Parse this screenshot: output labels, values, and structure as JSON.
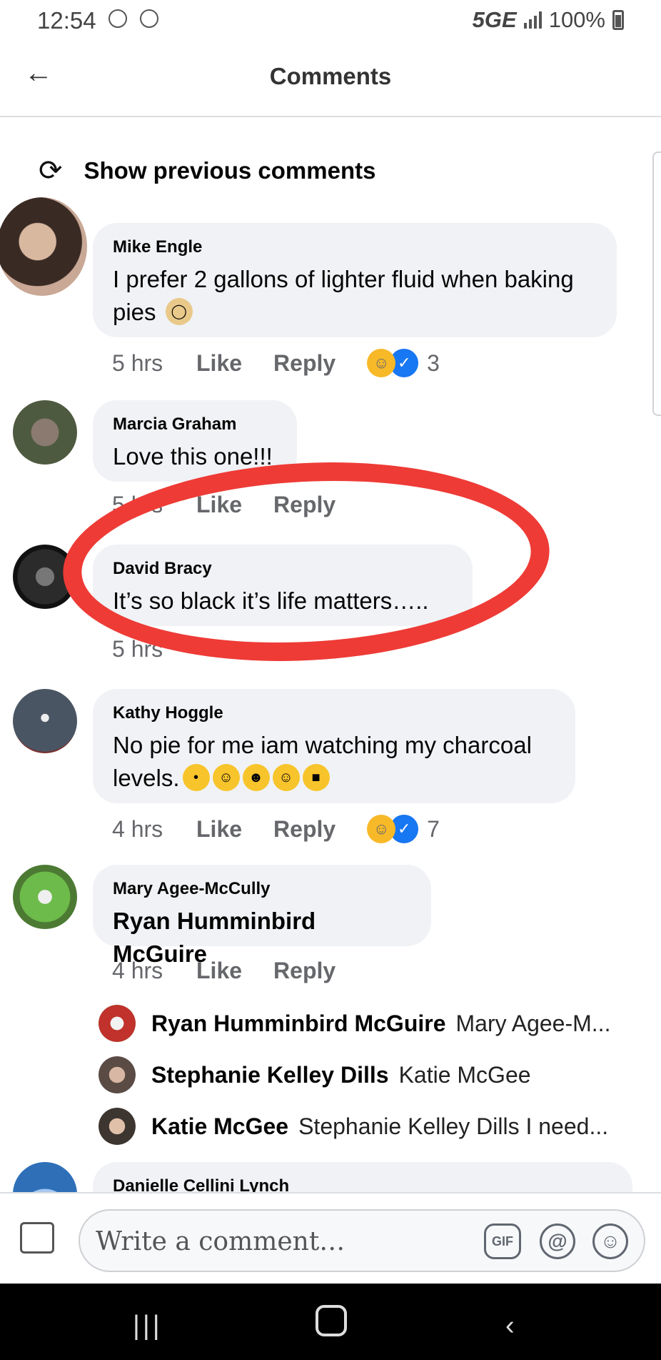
{
  "status_bar": {
    "time": "12:54",
    "network": "5GE",
    "battery": "100%"
  },
  "header": {
    "title": "Comments"
  },
  "show_previous": "Show previous comments",
  "comments": [
    {
      "author": "Mike Engle",
      "text": "I prefer 2 gallons of lighter fluid when baking pies",
      "time": "5 hrs",
      "like": "Like",
      "reply": "Reply",
      "reaction_count": "3"
    },
    {
      "author": "Marcia Graham",
      "text": "Love this one!!!",
      "time": "5 hrs",
      "like": "Like",
      "reply": "Reply"
    },
    {
      "author": "David Bracy",
      "text": "It’s so black it’s life matters…..",
      "time": "5 hrs"
    },
    {
      "author": "Kathy Hoggle",
      "text": "No pie for me iam watching my charcoal levels.",
      "time": "4 hrs",
      "like": "Like",
      "reply": "Reply",
      "reaction_count": "7"
    },
    {
      "author": "Mary Agee-McCully",
      "text": "Ryan Humminbird McGuire",
      "time": "4 hrs",
      "like": "Like",
      "reply": "Reply"
    }
  ],
  "replies": [
    {
      "name": "Ryan Humminbird McGuire",
      "text": "Mary Agee-M..."
    },
    {
      "name": "Stephanie Kelley Dills",
      "text": "Katie McGee"
    },
    {
      "name": "Katie McGee",
      "text": "Stephanie Kelley Dills I need..."
    }
  ],
  "next_author": "Danielle Cellini Lynch",
  "composer": {
    "placeholder": "Write a comment…",
    "gif_label": "GIF",
    "mention_label": "@"
  },
  "colors": {
    "bubble": "#f0f2f5",
    "meta": "#65676b",
    "annotation": "#ee3b36",
    "like_blue": "#1877f2",
    "haha_yellow": "#f7b928"
  },
  "icons": [
    "alarm-icon",
    "messenger-icon",
    "back-arrow-icon",
    "refresh-icon",
    "photo-icon",
    "gif-icon",
    "mention-icon",
    "emoji-icon"
  ]
}
